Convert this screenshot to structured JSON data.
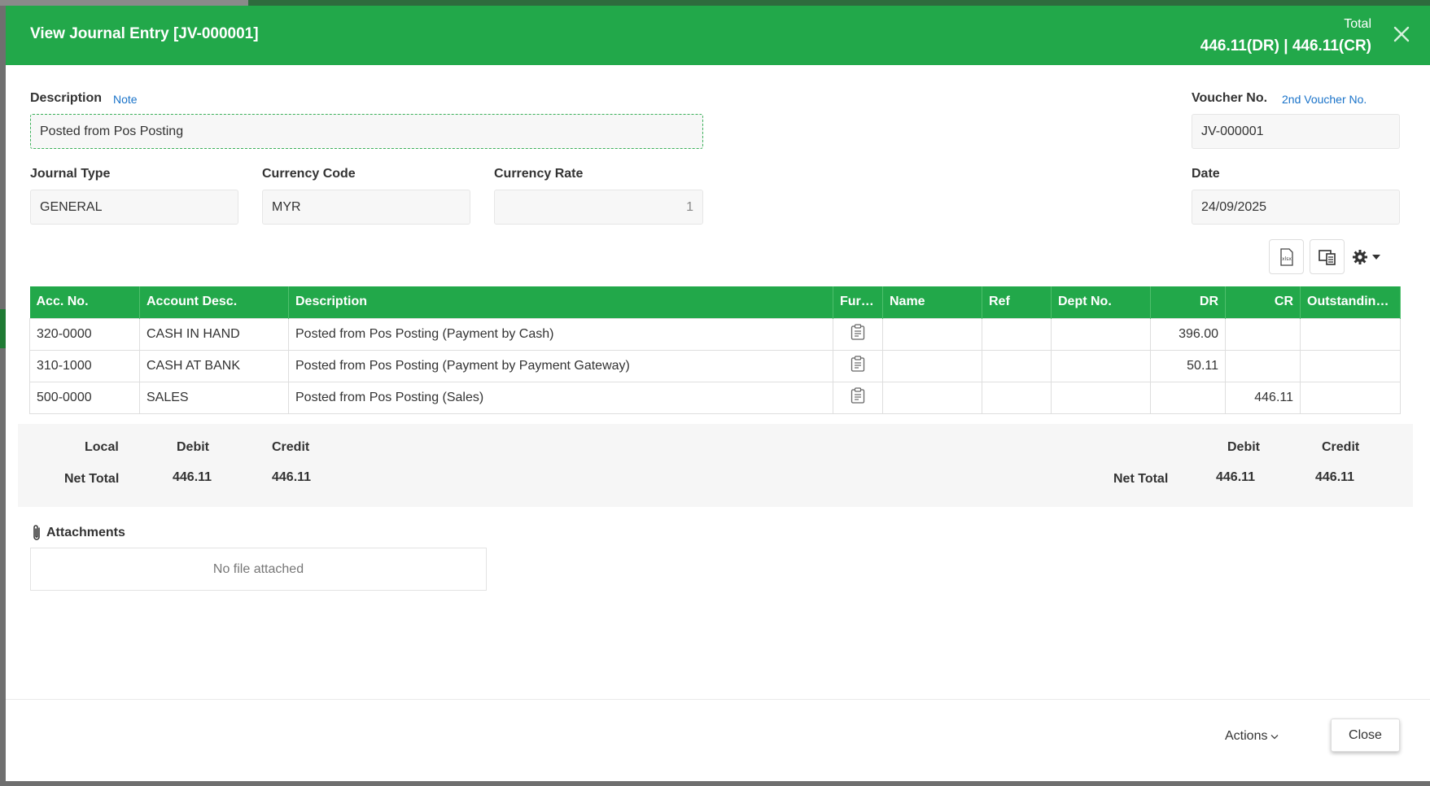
{
  "header": {
    "title": "View Journal Entry [JV-000001]",
    "total_label": "Total",
    "total_value": "446.11(DR) | 446.11(CR)"
  },
  "form": {
    "description_label": "Description",
    "note_link": "Note",
    "description_value": "Posted from Pos Posting",
    "voucher_label": "Voucher No.",
    "second_voucher_link": "2nd Voucher No.",
    "voucher_value": "JV-000001",
    "journal_type_label": "Journal Type",
    "journal_type_value": "GENERAL",
    "currency_code_label": "Currency Code",
    "currency_code_value": "MYR",
    "currency_rate_label": "Currency Rate",
    "currency_rate_value": "1",
    "date_label": "Date",
    "date_value": "24/09/2025"
  },
  "table": {
    "headers": [
      "Acc. No.",
      "Account Desc.",
      "Description",
      "Furt...",
      "Name",
      "Ref",
      "Dept No.",
      "DR",
      "CR",
      "Outstanding ..."
    ],
    "rows": [
      {
        "acc": "320-0000",
        "account_desc": "CASH IN HAND",
        "description": "Posted from Pos Posting (Payment by Cash)",
        "name": "",
        "ref": "",
        "dept": "",
        "dr": "396.00",
        "cr": "",
        "outstanding": ""
      },
      {
        "acc": "310-1000",
        "account_desc": "CASH AT BANK",
        "description": "Posted from Pos Posting (Payment by Payment Gateway)",
        "name": "",
        "ref": "",
        "dept": "",
        "dr": "50.11",
        "cr": "",
        "outstanding": ""
      },
      {
        "acc": "500-0000",
        "account_desc": "SALES",
        "description": "Posted from Pos Posting (Sales)",
        "name": "",
        "ref": "",
        "dept": "",
        "dr": "",
        "cr": "446.11",
        "outstanding": ""
      }
    ]
  },
  "summary": {
    "local_label": "Local",
    "debit_label": "Debit",
    "credit_label": "Credit",
    "net_total_label": "Net Total",
    "local_debit": "446.11",
    "local_credit": "446.11",
    "right_debit_label": "Debit",
    "right_credit_label": "Credit",
    "right_net_total_label": "Net Total",
    "right_debit": "446.11",
    "right_credit": "446.11"
  },
  "attachments": {
    "title": "Attachments",
    "empty_text": "No file attached"
  },
  "footer": {
    "actions_label": "Actions",
    "close_label": "Close"
  },
  "colors": {
    "header_green": "#22a84a",
    "link_blue": "#1a73c9"
  }
}
